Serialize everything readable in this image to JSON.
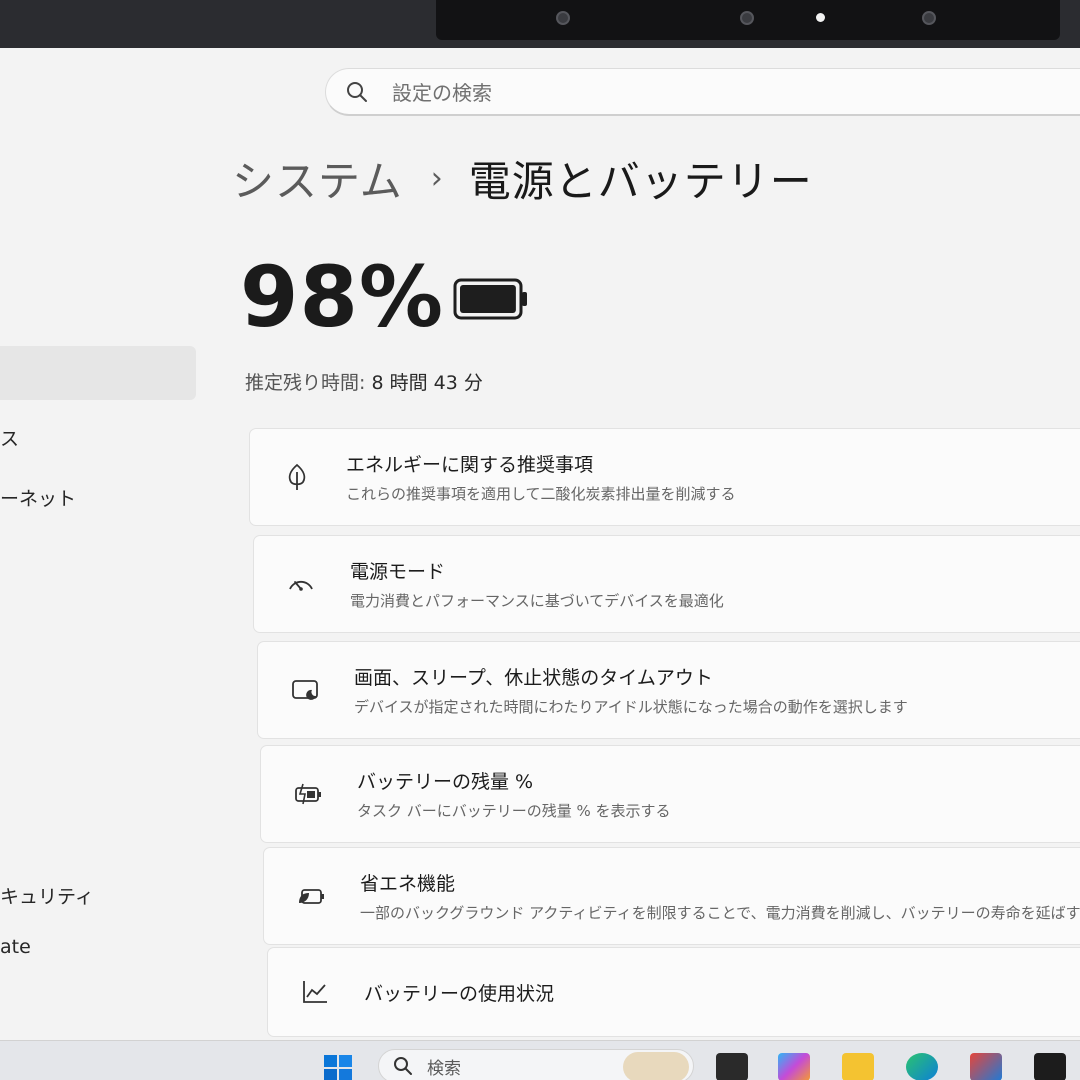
{
  "search": {
    "placeholder": "設定の検索"
  },
  "sidebar": {
    "items": [
      "ス",
      "ーネット",
      "キュリティ",
      "ate"
    ]
  },
  "breadcrumb": {
    "parent": "システム",
    "separator": "›",
    "current": "電源とバッテリー"
  },
  "battery": {
    "percent_text": "98%",
    "level": 0.98,
    "remaining_label": "推定残り時間:",
    "remaining_value": "8 時間 43 分"
  },
  "cards": [
    {
      "icon": "leaf-icon",
      "title": "エネルギーに関する推奨事項",
      "desc": "これらの推奨事項を適用して二酸化炭素排出量を削減する"
    },
    {
      "icon": "gauge-icon",
      "title": "電源モード",
      "desc": "電力消費とパフォーマンスに基づいてデバイスを最適化"
    },
    {
      "icon": "screen-sleep-icon",
      "title": "画面、スリープ、休止状態のタイムアウト",
      "desc": "デバイスが指定された時間にわたりアイドル状態になった場合の動作を選択します"
    },
    {
      "icon": "battery-charging-icon",
      "title": "バッテリーの残量 %",
      "desc": "タスク バーにバッテリーの残量 % を表示する"
    },
    {
      "icon": "battery-saver-icon",
      "title": "省エネ機能",
      "desc": "一部のバックグラウンド アクティビティを制限することで、電力消費を削減し、バッテリーの寿命を延ばす"
    },
    {
      "icon": "chart-icon",
      "title": "バッテリーの使用状況",
      "desc": ""
    }
  ],
  "taskbar": {
    "search_label": "検索"
  },
  "colors": {
    "accent": "#0067c0",
    "background": "#f3f3f3",
    "card": "#fbfbfb"
  }
}
